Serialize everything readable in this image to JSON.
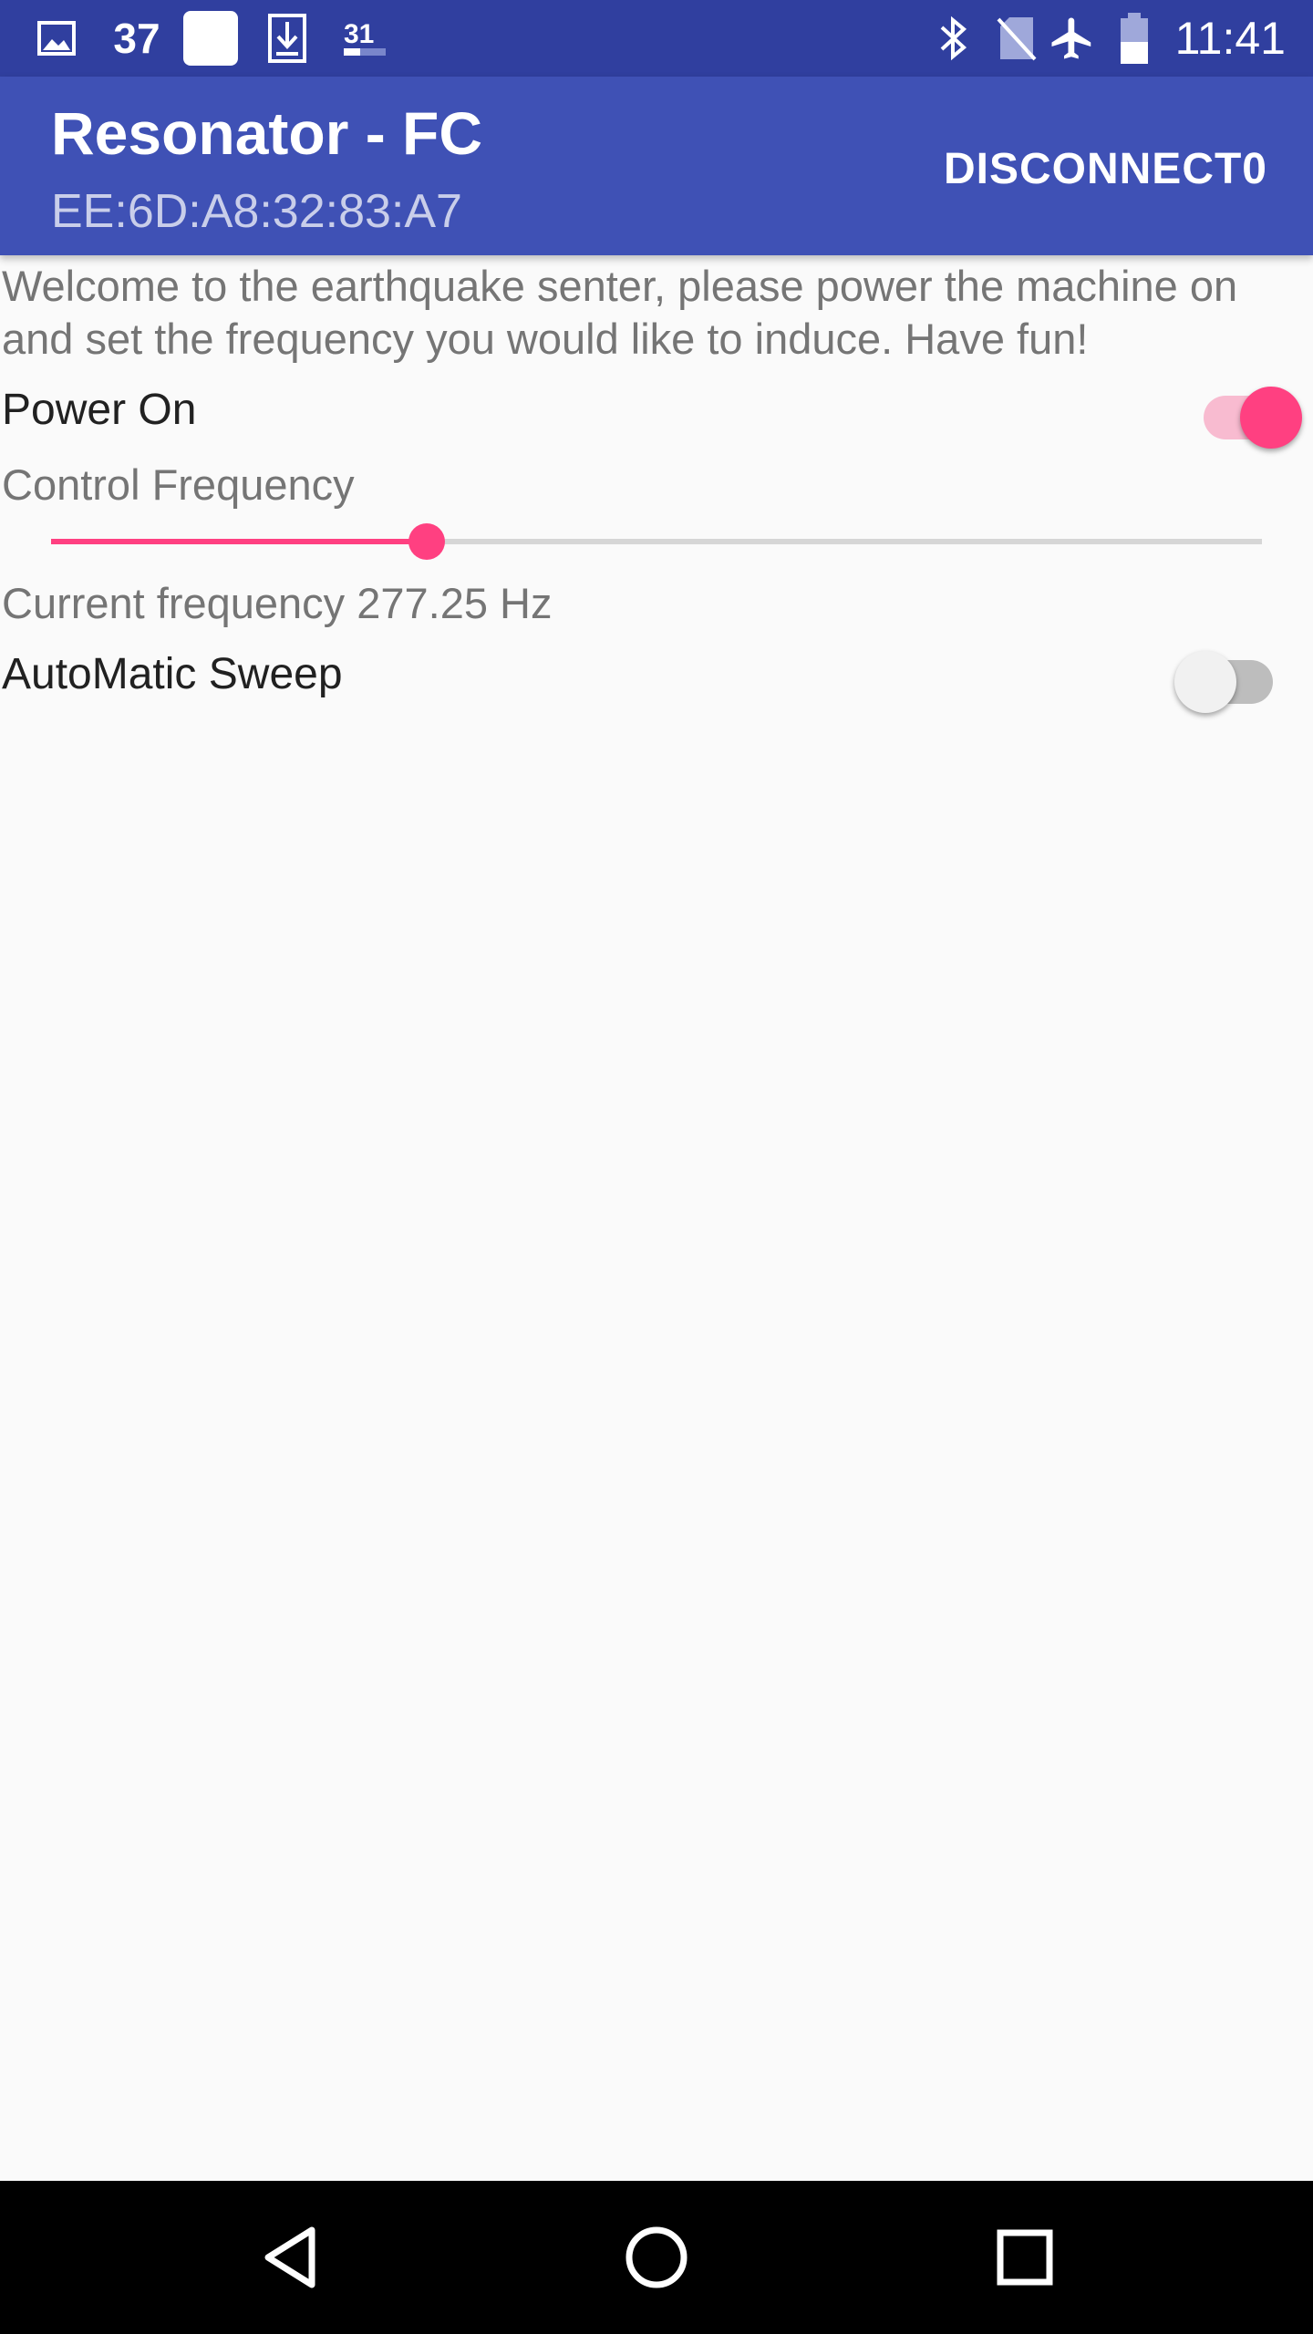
{
  "status_bar": {
    "notif_count": "37",
    "time": "11:41",
    "icons": [
      "image-icon",
      "notification-count-icon",
      "blank-app-icon",
      "download-icon",
      "calendar-icon",
      "bluetooth-icon",
      "no-sim-icon",
      "airplane-mode-icon",
      "battery-icon"
    ]
  },
  "app_bar": {
    "title": "Resonator - FC",
    "subtitle": "EE:6D:A8:32:83:A7",
    "action_label": "DISCONNECT0"
  },
  "content": {
    "welcome_text": "Welcome to the earthquake senter, please power the machine on and set the frequency you would like to induce. Have fun!",
    "power_label": "Power On",
    "power_on": true,
    "control_label": "Control Frequency",
    "slider_value_fraction": 0.31,
    "current_frequency_text": "Current frequency 277.25 Hz",
    "sweep_label": "AutoMatic Sweep",
    "sweep_on": false
  },
  "nav_bar": {
    "icons": [
      "back-icon",
      "home-icon",
      "recents-icon"
    ]
  },
  "colors": {
    "primary_dark": "#303f9f",
    "primary": "#3f51b5",
    "accent": "#ff4081"
  }
}
